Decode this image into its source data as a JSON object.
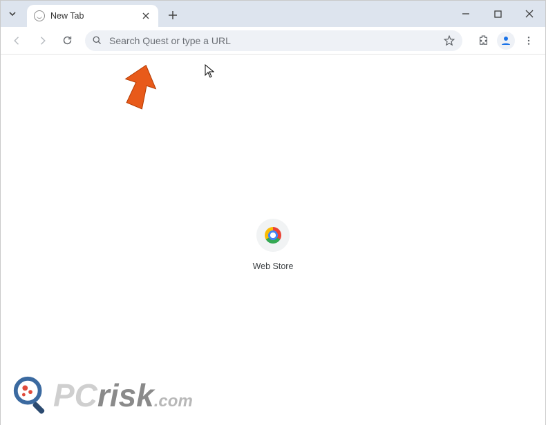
{
  "tab": {
    "title": "New Tab"
  },
  "omnibox": {
    "placeholder": "Search Quest or type a URL"
  },
  "shortcut": {
    "label": "Web Store"
  },
  "watermark": {
    "text_light": "PC",
    "text_dark": "risk",
    "tld": ".com"
  }
}
